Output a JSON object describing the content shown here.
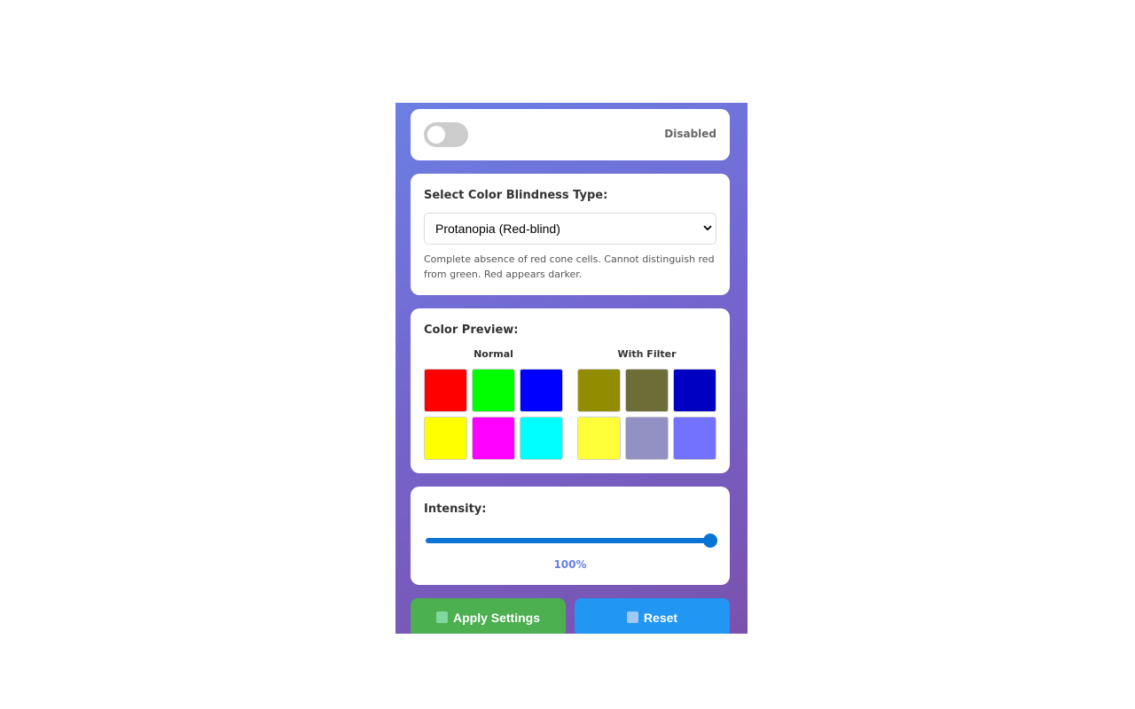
{
  "toggle": {
    "enabled": false,
    "status_text": "Disabled"
  },
  "type_section": {
    "title": "Select Color Blindness Type:",
    "selected": "Protanopia (Red-blind)",
    "description": "Complete absence of red cone cells. Cannot distinguish red from green. Red appears darker."
  },
  "preview": {
    "title": "Color Preview:",
    "normal_label": "Normal",
    "filtered_label": "With Filter",
    "normal_colors": [
      "#ff0000",
      "#00ff00",
      "#0000ff",
      "#ffff00",
      "#ff00ff",
      "#00ffff"
    ],
    "filtered_colors": [
      "#928c00",
      "#6c6d37",
      "#0000c3",
      "#fdfe37",
      "#9390c3",
      "#7372ff"
    ]
  },
  "intensity": {
    "title": "Intensity:",
    "value": 100,
    "value_text": "100%"
  },
  "buttons": {
    "apply_label": "Apply Settings",
    "reset_label": "Reset"
  },
  "colors": {
    "accent": "#667eea",
    "slider": "#0a74d4",
    "apply": "#4caf50",
    "reset": "#2196f3"
  }
}
